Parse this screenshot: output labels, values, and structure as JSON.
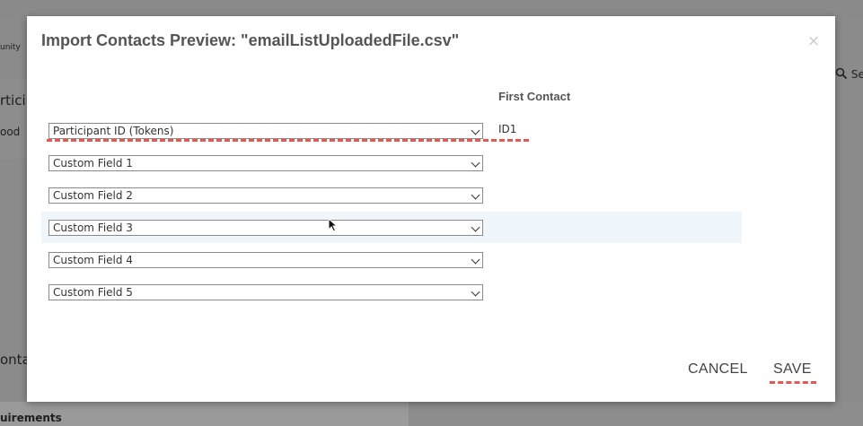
{
  "background": {
    "left_fragments": [
      "unity",
      "rticip",
      "ood",
      "onta",
      "uirements"
    ],
    "right_fragment": "Se"
  },
  "dialog": {
    "title": "Import Contacts Preview: \"emailListUploadedFile.csv\"",
    "close_glyph": "×",
    "column_header": "First Contact",
    "rows": [
      {
        "field": "Participant ID (Tokens)",
        "value": "ID1"
      },
      {
        "field": "Custom Field 1",
        "value": ""
      },
      {
        "field": "Custom Field 2",
        "value": ""
      },
      {
        "field": "Custom Field 3",
        "value": ""
      },
      {
        "field": "Custom Field 4",
        "value": ""
      },
      {
        "field": "Custom Field 5",
        "value": ""
      }
    ],
    "cancel_label": "CANCEL",
    "save_label": "SAVE"
  },
  "colors": {
    "annotation": "#e8574f",
    "title_text": "#555555",
    "row_highlight": "#eef6fc"
  }
}
